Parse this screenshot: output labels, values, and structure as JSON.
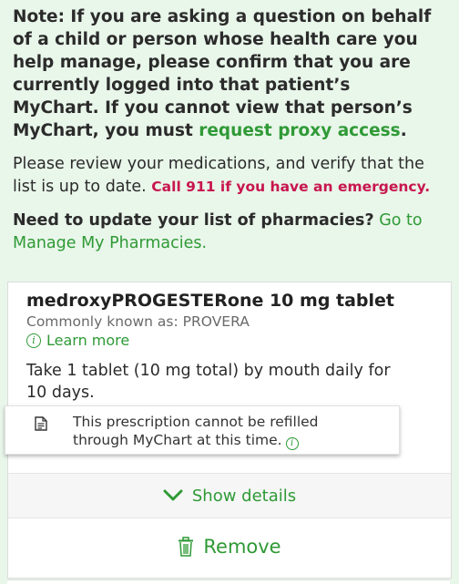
{
  "banner": {
    "note_text": "Note: If you are asking a question on behalf of a child or person whose health care you help manage, please confirm that you are currently logged into that patient’s MyChart. If you cannot view that person’s MyChart, you must ",
    "note_link": "request proxy access",
    "note_end": ".",
    "review_text": "Please review your medications, and verify that the list is up to date. ",
    "emergency_text": "Call 911 if you have an emergency.",
    "pharm_question": "Need to update your list of pharmacies?",
    "pharm_link": "Go to Manage My Pharmacies."
  },
  "medication": {
    "name": "medroxyPROGESTERone 10 mg tablet",
    "known_as": "Commonly known as: PROVERA",
    "learn_more": "Learn more",
    "instructions": "Take 1 tablet (10 mg total) by mouth daily for 10 days.",
    "refill_notice": "This prescription cannot be refilled through MyChart at this time.",
    "show_details": "Show details",
    "remove": "Remove"
  },
  "icons": {
    "info": "info-icon",
    "document": "document-icon",
    "chevron": "chevron-down-icon",
    "trash": "trash-icon"
  },
  "colors": {
    "background": "#e9f6ea",
    "accent_green": "#2f9a36",
    "emergency_red": "#c8164f"
  }
}
